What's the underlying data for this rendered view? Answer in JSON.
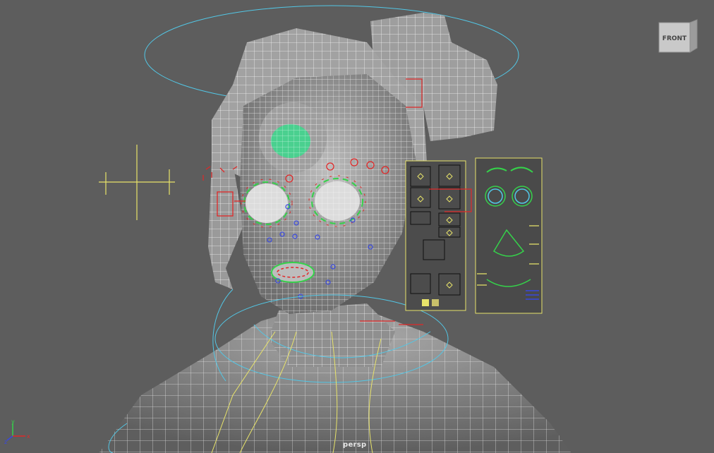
{
  "viewport": {
    "camera_label": "persp",
    "viewcube_face_label": "FRONT"
  },
  "axis_indicator": {
    "x_label": "x",
    "y_label": "y",
    "z_label": "z"
  },
  "colors": {
    "background": "#5d5d5d",
    "mesh_fill": "#9a9a9a",
    "mesh_wire": "#ffffff",
    "control_yellow": "#e8e36a",
    "control_cyan": "#52c7e6",
    "control_red": "#e02828",
    "control_green": "#35d24a",
    "control_blue": "#3848e0",
    "eye_highlight": "#2ee08a"
  },
  "icons": [
    "viewcube-icon",
    "axis-gizmo-icon",
    "locator-icon"
  ]
}
